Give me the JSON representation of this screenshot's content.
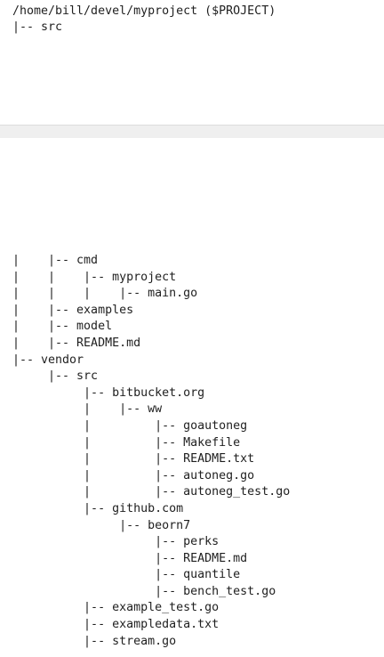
{
  "top_listing": {
    "lines": [
      "/home/bill/devel/myproject ($PROJECT)",
      "|-- src"
    ]
  },
  "bottom_listing": {
    "lines": [
      "|    |-- cmd",
      "|    |    |-- myproject",
      "|    |    |    |-- main.go",
      "|    |-- examples",
      "|    |-- model",
      "|    |-- README.md",
      "|-- vendor",
      "     |-- src",
      "          |-- bitbucket.org",
      "          |    |-- ww",
      "          |         |-- goautoneg",
      "          |         |-- Makefile",
      "          |         |-- README.txt",
      "          |         |-- autoneg.go",
      "          |         |-- autoneg_test.go",
      "          |-- github.com",
      "               |-- beorn7",
      "                    |-- perks",
      "                    |-- README.md",
      "                    |-- quantile",
      "                    |-- bench_test.go",
      "          |-- example_test.go",
      "          |-- exampledata.txt",
      "          |-- stream.go"
    ]
  }
}
